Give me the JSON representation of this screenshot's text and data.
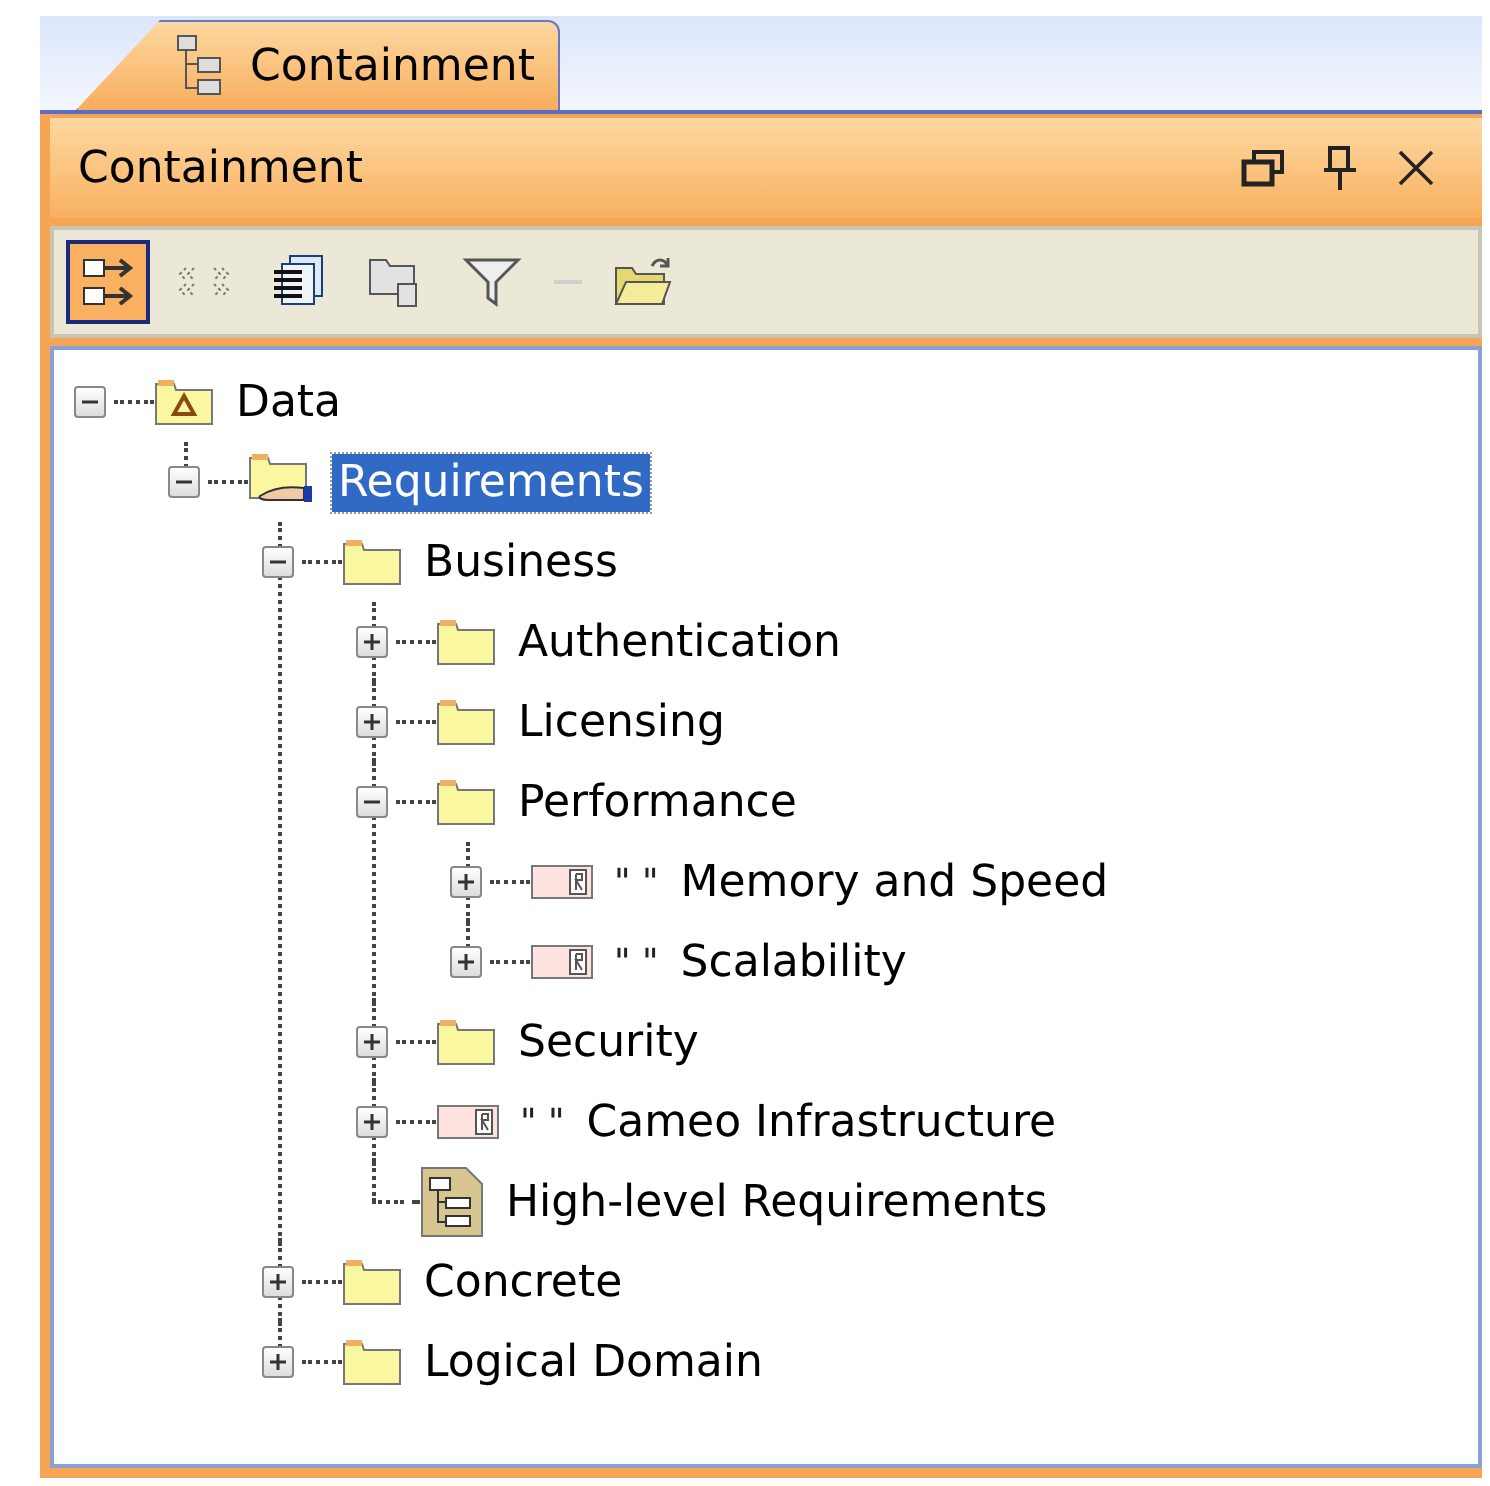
{
  "tab": {
    "label": "Containment",
    "selected": true
  },
  "panel": {
    "title": "Containment"
  },
  "toolbar": [
    {
      "kind": "expand",
      "selected": true
    },
    {
      "kind": "compartments",
      "selected": false
    },
    {
      "kind": "properties",
      "selected": false
    },
    {
      "kind": "package",
      "selected": false
    },
    {
      "kind": "filter",
      "selected": false
    },
    {
      "kind": "separator"
    },
    {
      "kind": "open",
      "selected": false
    }
  ],
  "tree": [
    {
      "label": "Data",
      "kind": "model",
      "expanded": true,
      "selected": false,
      "children": [
        {
          "label": "Requirements",
          "kind": "shared-folder",
          "expanded": true,
          "selected": true,
          "children": [
            {
              "label": "Business",
              "kind": "folder",
              "expanded": true,
              "selected": false,
              "children": [
                {
                  "label": "Authentication",
                  "kind": "folder",
                  "expanded": false,
                  "selected": false
                },
                {
                  "label": "Licensing",
                  "kind": "folder",
                  "expanded": false,
                  "selected": false
                },
                {
                  "label": "Performance",
                  "kind": "folder",
                  "expanded": true,
                  "selected": false,
                  "children": [
                    {
                      "label": "Memory and Speed",
                      "prefix": "\" \"",
                      "kind": "requirement",
                      "expanded": false,
                      "selected": false
                    },
                    {
                      "label": "Scalability",
                      "prefix": "\" \"",
                      "kind": "requirement",
                      "expanded": false,
                      "selected": false
                    }
                  ]
                },
                {
                  "label": "Security",
                  "kind": "folder",
                  "expanded": false,
                  "selected": false
                },
                {
                  "label": "Cameo Infrastructure",
                  "prefix": "\" \"",
                  "kind": "requirement",
                  "expanded": false,
                  "selected": false
                },
                {
                  "label": "High-level Requirements",
                  "kind": "diagram",
                  "selected": false
                }
              ]
            },
            {
              "label": "Concrete",
              "kind": "folder",
              "expanded": false,
              "selected": false
            },
            {
              "label": "Logical Domain",
              "kind": "folder",
              "expanded": false,
              "selected": false
            }
          ]
        }
      ]
    }
  ]
}
